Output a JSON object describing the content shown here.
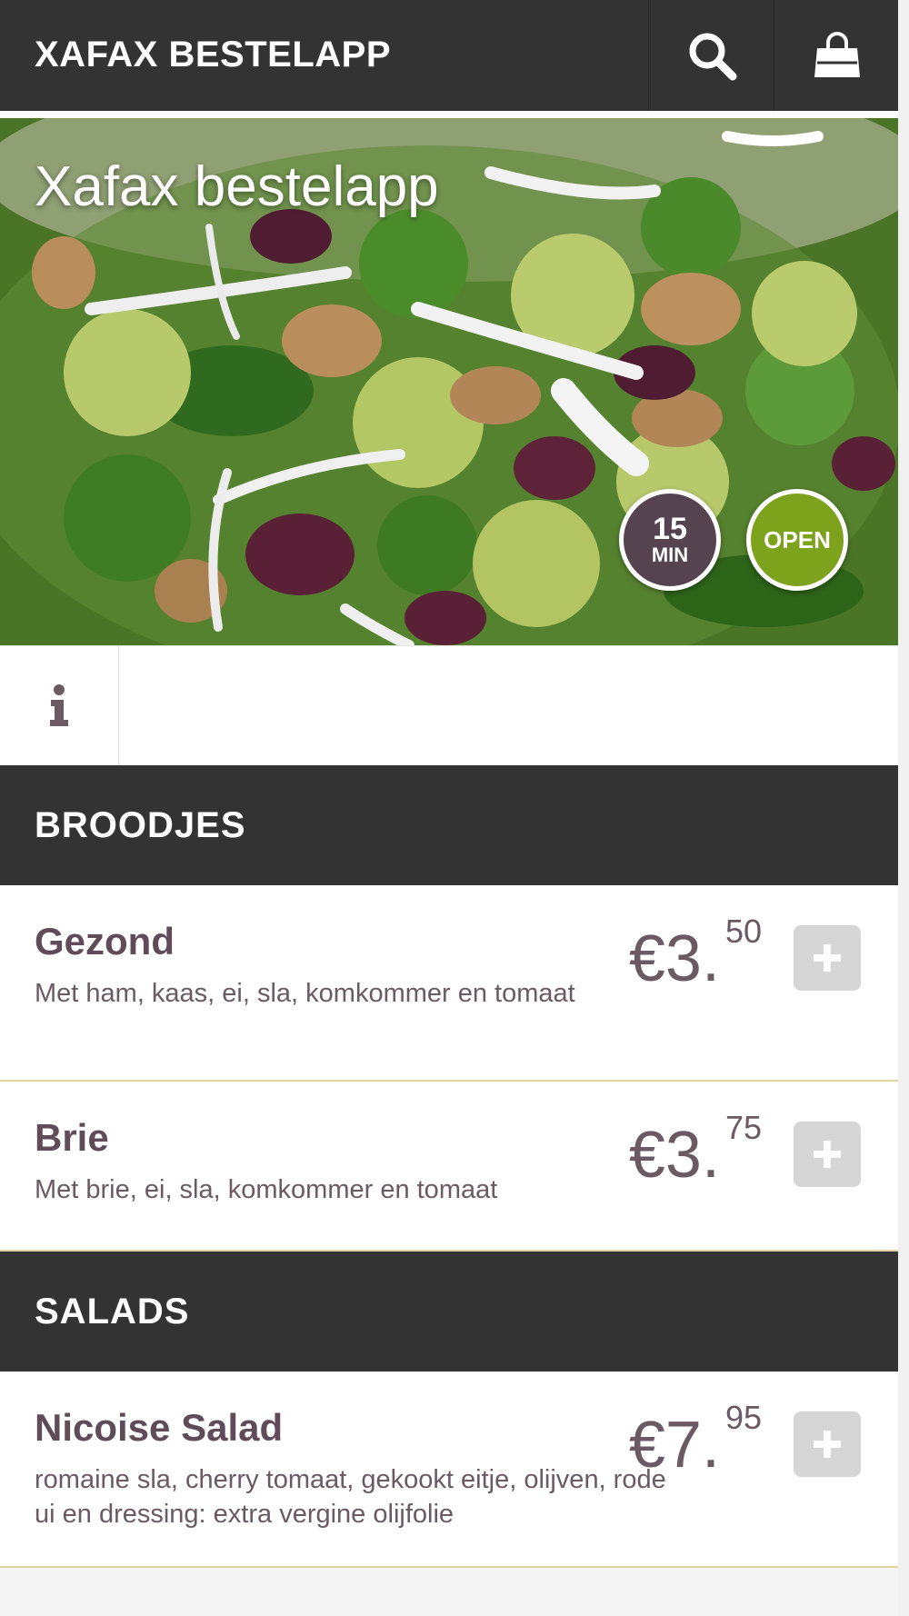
{
  "header": {
    "brand": "XAFAX BESTELAPP",
    "search_icon": "search-icon",
    "cart_icon": "shopping-bag-icon"
  },
  "hero": {
    "title": "Xafax bestelapp",
    "time_badge": {
      "value": "15",
      "unit": "MIN"
    },
    "status_badge": "OPEN",
    "colors": {
      "time": "#55444f",
      "open": "#7da21c"
    }
  },
  "info": {
    "icon": "info-icon"
  },
  "categories": [
    {
      "name": "BROODJES",
      "items": [
        {
          "name": "Gezond",
          "description": "Met ham, kaas, ei, sla, komkommer en tomaat",
          "price_main": "€3.",
          "price_cents": "50"
        },
        {
          "name": "Brie",
          "description": "Met brie, ei, sla, komkommer en tomaat",
          "price_main": "€3.",
          "price_cents": "75"
        }
      ]
    },
    {
      "name": "SALADS",
      "items": [
        {
          "name": "Nicoise Salad",
          "description": "romaine sla, cherry tomaat, gekookt eitje, olijven, rode ui en dressing: extra vergine olijfolie",
          "price_main": "€7.",
          "price_cents": "95"
        }
      ]
    }
  ],
  "colors": {
    "topbar": "#333333",
    "item_text": "#5f4c58",
    "divider": "#e2d3a2",
    "add_button": "#d6d6d6"
  }
}
